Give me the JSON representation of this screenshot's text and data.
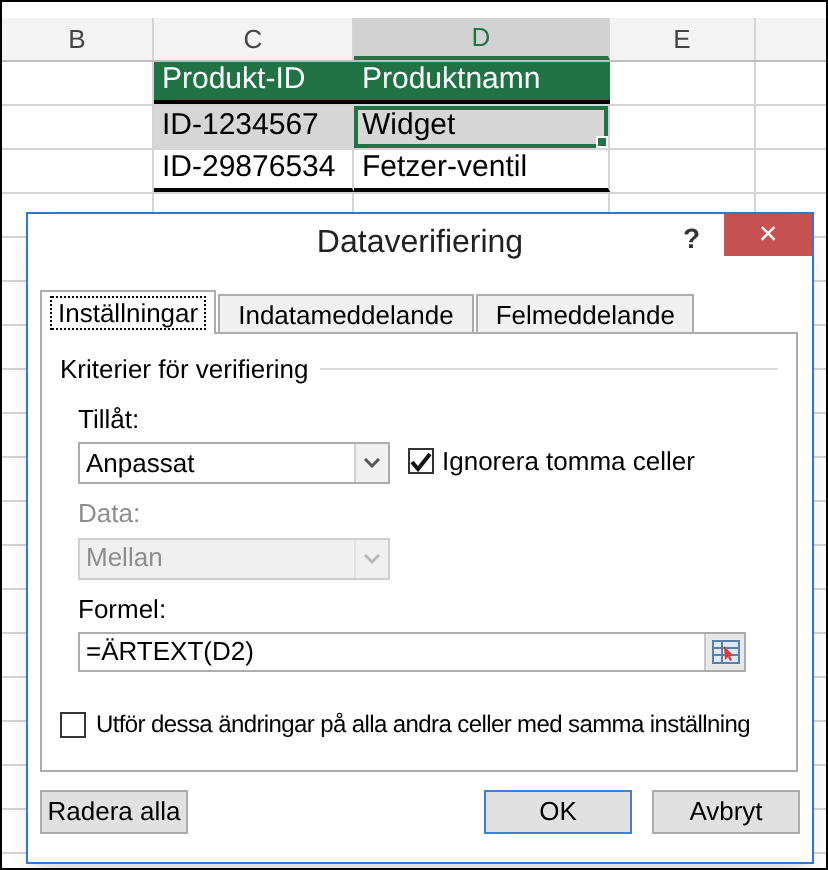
{
  "spreadsheet": {
    "columns": [
      {
        "label": "B",
        "selected": false
      },
      {
        "label": "C",
        "selected": false
      },
      {
        "label": "D",
        "selected": true
      },
      {
        "label": "E",
        "selected": false
      }
    ],
    "table": {
      "headers": [
        "Produkt-ID",
        "Produktnamn"
      ],
      "rows": [
        {
          "cells": [
            "ID-1234567",
            "Widget"
          ],
          "selected": true
        },
        {
          "cells": [
            "ID-29876534",
            "Fetzer-ventil"
          ],
          "selected": false
        }
      ]
    }
  },
  "dialog": {
    "title": "Dataverifiering",
    "help": "?",
    "close": "×",
    "tabs": [
      {
        "label": "Inställningar",
        "selected": true
      },
      {
        "label": "Indatameddelande",
        "selected": false
      },
      {
        "label": "Felmeddelande",
        "selected": false
      }
    ],
    "group": "Kriterier för verifiering",
    "allow": {
      "label": "Tillåt:",
      "value": "Anpassat",
      "disabled": false
    },
    "ignore_blank": {
      "label": "Ignorera tomma celler",
      "checked": true
    },
    "data": {
      "label": "Data:",
      "value": "Mellan",
      "disabled": true
    },
    "formula": {
      "label": "Formel:",
      "value": "=ÄRTEXT(D2)"
    },
    "apply_all": {
      "label": "Utför dessa ändringar på alla andra celler med samma inställning",
      "checked": false
    },
    "buttons": [
      {
        "label": "Radera alla",
        "default": false
      },
      {
        "label": "OK",
        "default": true
      },
      {
        "label": "Avbryt",
        "default": false
      }
    ]
  }
}
